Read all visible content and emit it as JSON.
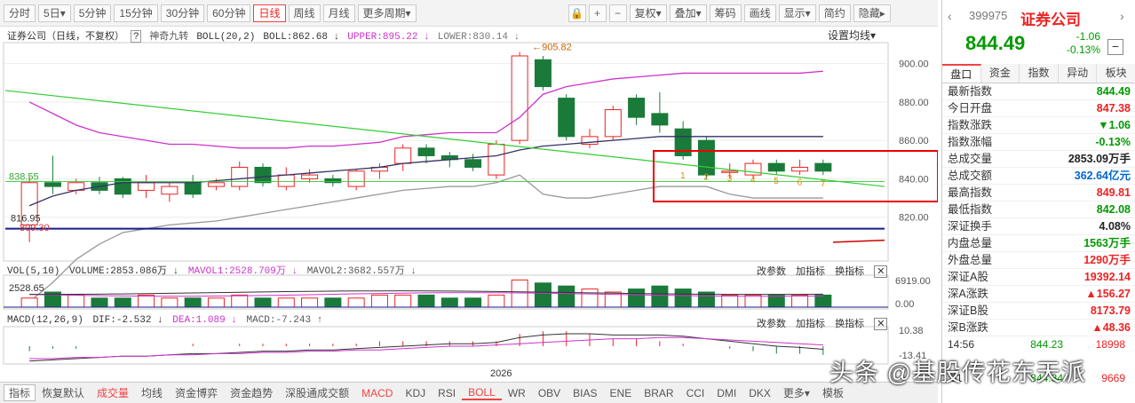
{
  "toolbar": {
    "buttons": [
      "分时",
      "5日▾",
      "5分钟",
      "15分钟",
      "30分钟",
      "60分钟",
      "日线",
      "周线",
      "月线",
      "更多周期▾"
    ],
    "active_index": 6,
    "right_buttons": [
      "复权▾",
      "叠加▾",
      "筹码",
      "画线",
      "显示▾",
      "简约",
      "隐藏▸"
    ],
    "icons": [
      "lock-icon",
      "plus-icon",
      "minus-icon"
    ]
  },
  "main_header": {
    "name": "证券公司（日线，不复权）",
    "help": "?",
    "indicator": "神奇九转",
    "boll": "BOLL(20,2)",
    "boll_val": "BOLL:862.68 ↓",
    "upper": "UPPER:895.22 ↓",
    "lower": "LOWER:830.14 ↓",
    "settings": "设置均线▾"
  },
  "price_axis": [
    "900.00",
    "880.00",
    "860.00",
    "840.00",
    "820.00"
  ],
  "price_annotations": {
    "high": "905.82",
    "left_level": "838.55",
    "low1": "816.95",
    "low2": "809.30"
  },
  "nine_counts": [
    "1",
    "2",
    "3",
    "4",
    "5",
    "6",
    "7"
  ],
  "vol_header": {
    "title": "VOL(5,10)",
    "volume": "VOLUME:2853.086万 ↓",
    "mavol1": "MAVOL1:2528.709万 ↓",
    "mavol2": "MAVOL2:3682.557万 ↓",
    "buttons": [
      "改参数",
      "加指标",
      "换指标"
    ],
    "left_value": "2528.65",
    "axis": [
      "6919.00",
      "0.00"
    ]
  },
  "macd_header": {
    "title": "MACD(12,26,9)",
    "dif": "DIF:-2.532 ↓",
    "dea": "DEA:1.089 ↓",
    "macd": "MACD:-7.243 ↑",
    "buttons": [
      "改参数",
      "加指标",
      "换指标"
    ],
    "axis": [
      "10.38",
      "-13.41"
    ]
  },
  "date_label": "2026",
  "bottom_tabs": [
    "指标",
    "恢复默认",
    "成交量",
    "均线",
    "资金博弈",
    "资金趋势",
    "深股通成交额",
    "MACD",
    "KDJ",
    "RSI",
    "BOLL",
    "WR",
    "OBV",
    "BIAS",
    "ENE",
    "BRAR",
    "CCI",
    "DMI",
    "DKX",
    "更多▾",
    "模板"
  ],
  "sidebar": {
    "code": "399975",
    "name": "证券公司",
    "price": "844.49",
    "change": "-1.06",
    "change_pct": "-0.13%",
    "tabs": [
      "盘口",
      "资金",
      "指数",
      "异动",
      "板块"
    ],
    "rows": [
      {
        "k": "最新指数",
        "v": "844.49",
        "c": "g"
      },
      {
        "k": "今日开盘",
        "v": "847.38",
        "c": "r"
      },
      {
        "k": "指数涨跌",
        "v": "▼1.06",
        "c": "g"
      },
      {
        "k": "指数涨幅",
        "v": "-0.13%",
        "c": "g"
      },
      {
        "k": "总成交量",
        "v": "2853.09万手",
        "c": "k2"
      },
      {
        "k": "总成交额",
        "v": "362.64亿元",
        "c": "b"
      },
      {
        "k": "最高指数",
        "v": "849.81",
        "c": "r"
      },
      {
        "k": "最低指数",
        "v": "842.08",
        "c": "g"
      },
      {
        "k": "深证换手",
        "v": "4.08%",
        "c": "k2"
      },
      {
        "k": "内盘总量",
        "v": "1563万手",
        "c": "g"
      },
      {
        "k": "外盘总量",
        "v": "1290万手",
        "c": "r"
      },
      {
        "k": "深证A股",
        "v": "19392.14",
        "c": "r"
      },
      {
        "k": "深A涨跌",
        "v": "▲156.27",
        "c": "r"
      },
      {
        "k": "深证B股",
        "v": "8173.79",
        "c": "r"
      },
      {
        "k": "深B涨跌",
        "v": "▲48.36",
        "c": "r"
      }
    ],
    "ticks": [
      {
        "t": "14:56",
        "p": "844.23",
        "v": "18998"
      },
      {
        "t": "",
        "p": "",
        "v": ""
      },
      {
        "t": ":51",
        "p": "844.34",
        "v": "9669"
      }
    ]
  },
  "watermark": "头条 @基股传花东天派",
  "colors": {
    "up": "#e22",
    "down": "#1a7a3a",
    "boll_mid": "#333366",
    "upper": "#cc33cc",
    "lower": "#999999",
    "trend": "#33cc33"
  }
}
